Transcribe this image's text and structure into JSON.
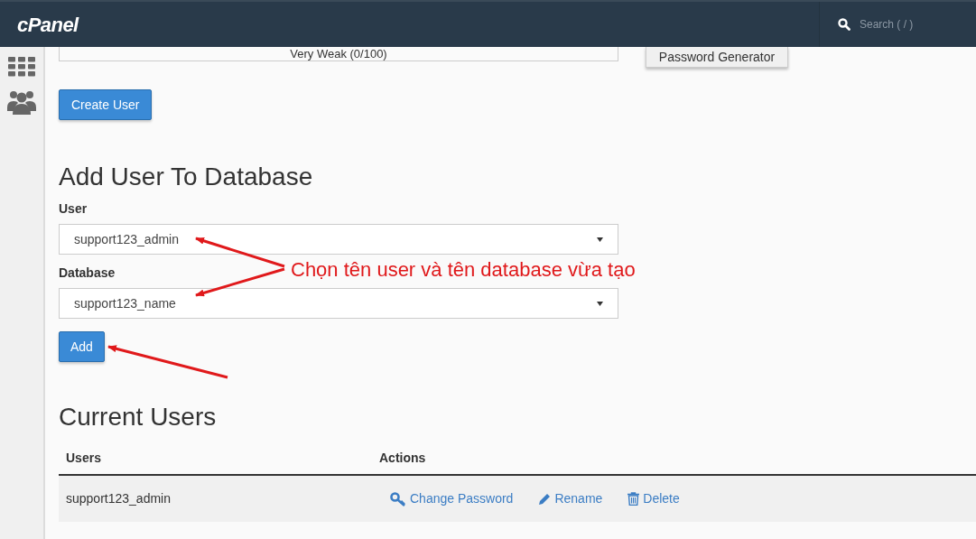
{
  "header": {
    "logo": "cPanel",
    "search_placeholder": "Search ( / )"
  },
  "create_user": {
    "strength": {
      "text": "Very Weak (0/100)"
    },
    "generator_button": "Password Generator",
    "create_button": "Create User"
  },
  "add_user": {
    "title": "Add User To Database",
    "fields": [
      {
        "label": "User",
        "value": "support123_admin"
      },
      {
        "label": "Database",
        "value": "support123_name"
      }
    ],
    "add_button": "Add"
  },
  "annotation": {
    "text": "Chọn tên user và tên database vừa tạo"
  },
  "current_users": {
    "title": "Current Users",
    "columns": [
      "Users",
      "Actions"
    ],
    "rows": [
      {
        "user": "support123_admin",
        "actions": [
          {
            "kind": "key",
            "label": "Change Password"
          },
          {
            "kind": "pencil",
            "label": "Rename"
          },
          {
            "kind": "trash",
            "label": "Delete"
          }
        ]
      }
    ]
  }
}
